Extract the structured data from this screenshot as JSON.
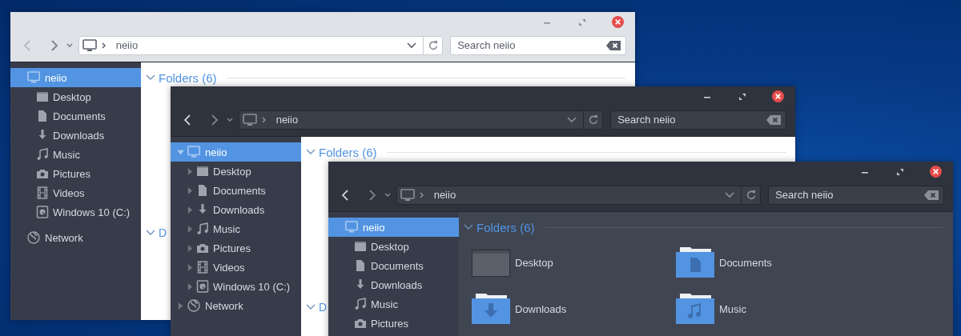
{
  "windows": [
    {
      "kind": "light",
      "address": "neiio",
      "search": {
        "placeholder": "Search neiio"
      },
      "sidebar": {
        "items": [
          {
            "label": "neiio",
            "kind": "computer",
            "selected": true,
            "children": [
              {
                "label": "Desktop",
                "kind": "desktop",
                "selected": false
              },
              {
                "label": "Documents",
                "kind": "document",
                "selected": false
              },
              {
                "label": "Downloads",
                "kind": "download",
                "selected": false
              },
              {
                "label": "Music",
                "kind": "music",
                "selected": false
              },
              {
                "label": "Pictures",
                "kind": "camera",
                "selected": false
              },
              {
                "label": "Videos",
                "kind": "film",
                "selected": false
              },
              {
                "label": "Windows 10 (C:)",
                "kind": "drive",
                "selected": false
              }
            ]
          },
          {
            "label": "Network",
            "kind": "network",
            "selected": false
          }
        ]
      },
      "content": {
        "heading": "Folders (6)",
        "heading_2": "D"
      }
    },
    {
      "kind": "mixed",
      "address": "neiio",
      "search": {
        "placeholder": "Search neiio"
      },
      "sidebar": {
        "items": [
          {
            "label": "neiio",
            "kind": "computer",
            "selected": true,
            "expanded": true,
            "children": [
              {
                "label": "Desktop",
                "kind": "desktop",
                "selected": false,
                "expanded": false
              },
              {
                "label": "Documents",
                "kind": "document",
                "selected": false,
                "expanded": false
              },
              {
                "label": "Downloads",
                "kind": "download",
                "selected": false,
                "expanded": false
              },
              {
                "label": "Music",
                "kind": "music",
                "selected": false,
                "expanded": false
              },
              {
                "label": "Pictures",
                "kind": "camera",
                "selected": false,
                "expanded": false
              },
              {
                "label": "Videos",
                "kind": "film",
                "selected": false,
                "expanded": false
              },
              {
                "label": "Windows 10 (C:)",
                "kind": "drive",
                "selected": false,
                "expanded": false
              }
            ]
          },
          {
            "label": "Network",
            "kind": "network",
            "selected": false,
            "expanded": false
          }
        ]
      },
      "content": {
        "heading": "Folders (6)",
        "heading_2": "D"
      }
    },
    {
      "kind": "dark",
      "address": "neiio",
      "search": {
        "placeholder": "Search neiio"
      },
      "sidebar": {
        "items": [
          {
            "label": "neiio",
            "kind": "computer",
            "selected": true,
            "children": [
              {
                "label": "Desktop",
                "kind": "desktop",
                "selected": false
              },
              {
                "label": "Documents",
                "kind": "document",
                "selected": false
              },
              {
                "label": "Downloads",
                "kind": "download",
                "selected": false
              },
              {
                "label": "Music",
                "kind": "music",
                "selected": false
              },
              {
                "label": "Pictures",
                "kind": "camera",
                "selected": false
              }
            ]
          }
        ]
      },
      "content": {
        "heading": "Folders (6)",
        "folders": [
          {
            "label": "Desktop",
            "kind": "desktop"
          },
          {
            "label": "Documents",
            "kind": "document"
          },
          {
            "label": "Downloads",
            "kind": "download"
          },
          {
            "label": "Music",
            "kind": "music"
          }
        ]
      }
    }
  ]
}
